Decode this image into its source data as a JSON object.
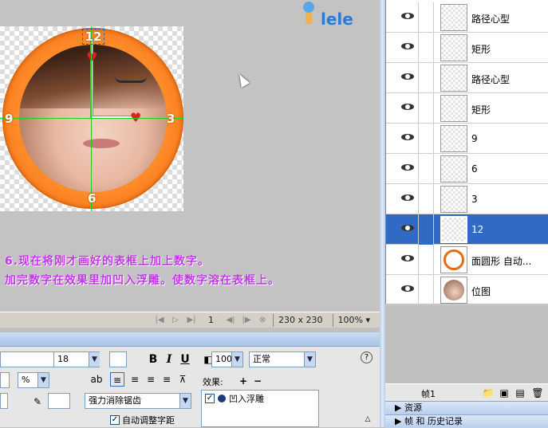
{
  "canvas": {
    "clock_numbers": {
      "n12": "12",
      "n3": "3",
      "n6": "6",
      "n9": "9"
    },
    "logo_text": "lele",
    "caption_line1": "6.现在将刚才画好的表框上加上数字。",
    "caption_line2": "加完数字在效果里加凹入浮雕。使数字溶在表框上。",
    "accent_color": "#ff7a1a",
    "caption_color": "#c036e8"
  },
  "status_bar": {
    "frame_number": "1",
    "dimensions": "230 x 230",
    "zoom": "100%"
  },
  "properties": {
    "font_size": "18",
    "unit_selector": "%",
    "bold_label": "B",
    "italic_label": "I",
    "underline_label": "U",
    "opacity": "100",
    "blend_mode": "正常",
    "antialias_mode": "强力消除锯齿",
    "effects_label": "效果:",
    "effect_item": "凹入浮雕",
    "auto_kern_label": "自动调整字距",
    "help_label": "?"
  },
  "layers": [
    {
      "name": "路径心型",
      "selected": false
    },
    {
      "name": "矩形",
      "selected": false
    },
    {
      "name": "路径心型",
      "selected": false
    },
    {
      "name": "矩形",
      "selected": false
    },
    {
      "name": "9",
      "selected": false
    },
    {
      "name": "6",
      "selected": false
    },
    {
      "name": "3",
      "selected": false
    },
    {
      "name": "12",
      "selected": true
    },
    {
      "name": "面圆形 自动...",
      "selected": false
    },
    {
      "name": "位图",
      "selected": false
    }
  ],
  "frames_bar": {
    "frame_label": "帧1"
  },
  "panels": {
    "assets": "资源",
    "frames_history": "帧 和 历史记录"
  }
}
